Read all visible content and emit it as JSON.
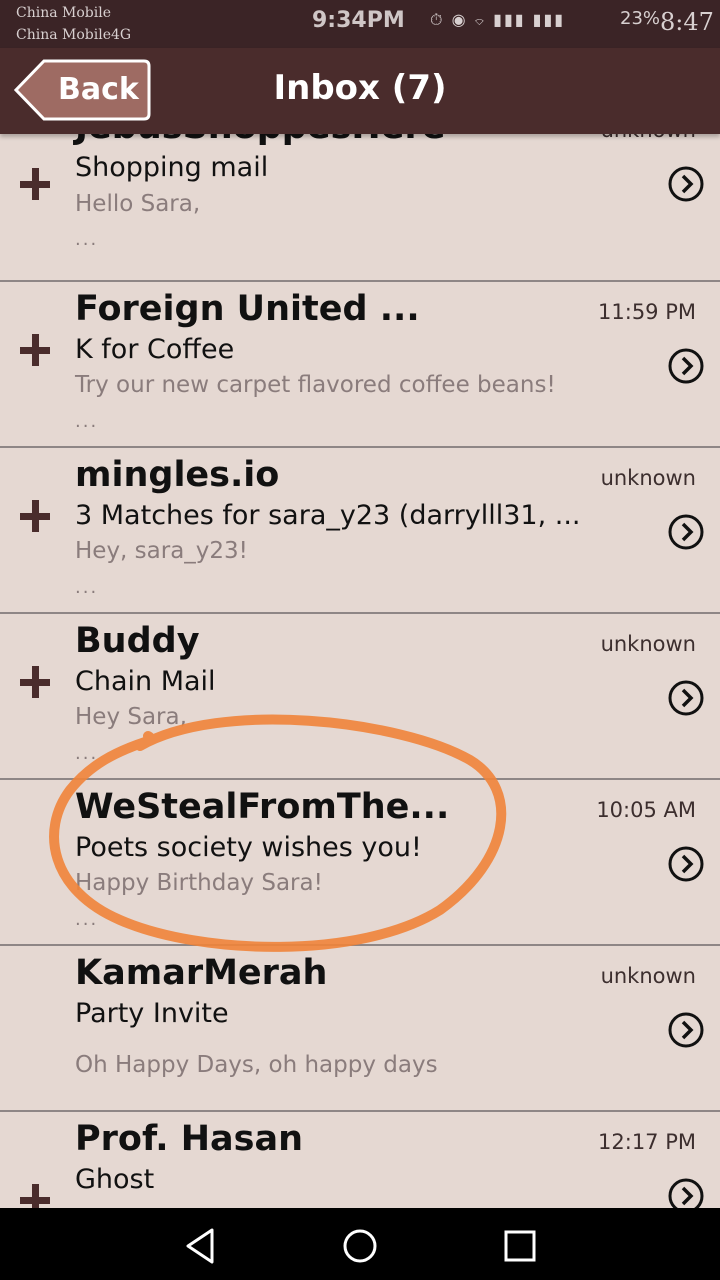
{
  "status_bar": {
    "carrier_1": "China Mobile",
    "carrier_2": "China Mobile4G",
    "time": "9:34PM",
    "icons": "⏱ ◉ ⌔ ▮▮▮ ▮▮▮",
    "battery": "23%",
    "overlay_time": "8:47"
  },
  "header": {
    "back_label": "Back",
    "title": "Inbox (7)"
  },
  "messages": [
    {
      "sender": "JebusShoppesHere",
      "time": "unknown",
      "subject": "Shopping mail",
      "preview": "Hello Sara,",
      "ellipsis": "...",
      "has_plus": true
    },
    {
      "sender": " Foreign United ...",
      "time": "11:59 PM",
      "subject": "K for Coffee",
      "preview": "Try our new carpet flavored coffee beans!",
      "ellipsis": "...",
      "has_plus": true
    },
    {
      "sender": "mingles.io",
      "time": "unknown",
      "subject": "3 Matches for sara_y23 (darrylll31, ...",
      "preview": "Hey, sara_y23!",
      "ellipsis": "...",
      "has_plus": true
    },
    {
      "sender": "Buddy",
      "time": "unknown",
      "subject": "Chain Mail",
      "preview": "Hey Sara,",
      "ellipsis": "...",
      "has_plus": true
    },
    {
      "sender": "WeStealFromThe...",
      "time": "10:05 AM",
      "subject": "Poets society wishes you!",
      "preview": "Happy Birthday Sara!",
      "ellipsis": "...",
      "has_plus": false
    },
    {
      "sender": "KamarMerah",
      "time": "unknown",
      "subject": "Party Invite",
      "preview": "Oh Happy Days, oh happy days",
      "ellipsis": "",
      "has_plus": false
    },
    {
      "sender": "Prof. Hasan",
      "time": "12:17 PM",
      "subject": "Ghost",
      "preview": "",
      "ellipsis": "",
      "has_plus": true
    }
  ],
  "colors": {
    "header_bg": "#4a2c2c",
    "list_bg": "#e5d8d2",
    "annotation": "#f0843a"
  }
}
